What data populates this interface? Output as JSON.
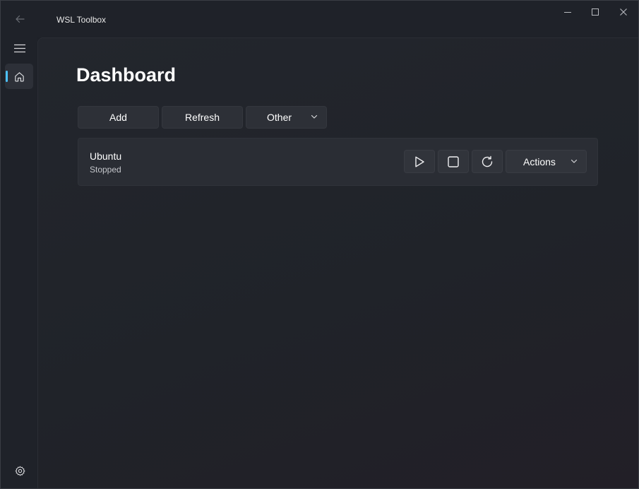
{
  "window": {
    "app_title": "WSL Toolbox"
  },
  "nav": {
    "items": [
      {
        "name": "home",
        "icon": "home-icon",
        "selected": true
      }
    ],
    "settings_icon": "gear-icon",
    "accent": "#4cc2ff"
  },
  "page": {
    "title": "Dashboard"
  },
  "commands": {
    "add_label": "Add",
    "refresh_label": "Refresh",
    "other_label": "Other"
  },
  "distros": [
    {
      "name": "Ubuntu",
      "status": "Stopped",
      "actions_label": "Actions"
    }
  ]
}
